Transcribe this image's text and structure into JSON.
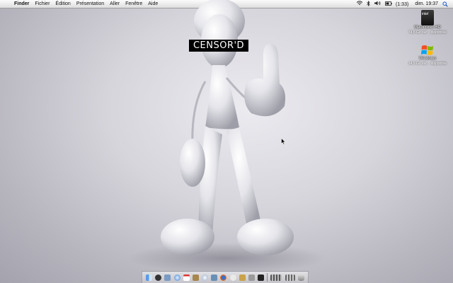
{
  "menubar": {
    "apple_glyph": "",
    "app_name": "Finder",
    "menus": [
      "Fichier",
      "Édition",
      "Présentation",
      "Aller",
      "Fenêtre",
      "Aide"
    ],
    "battery": "(1:33)",
    "clock": "dim. 19:37"
  },
  "desktop": {
    "drives": [
      {
        "name": "Macintosh HD",
        "info": "74,5 Go sur .. disponible"
      },
      {
        "name": "Windows",
        "info": "14,9 Go sur .. disponible"
      }
    ],
    "drive_badge": "intel",
    "wallpaper_caption": "CENSOR'D"
  },
  "dock": {
    "icons": [
      "finder",
      "dashboard",
      "mail",
      "safari",
      "ical",
      "addressbook",
      "itunes",
      "iphoto",
      "firefox",
      "ichat",
      "preview",
      "system-preferences",
      "terminal",
      "applications-stack",
      "documents-stack",
      "trash"
    ]
  },
  "colors": {
    "desktop": "#d6d5dc",
    "menubar": "#efefef"
  }
}
